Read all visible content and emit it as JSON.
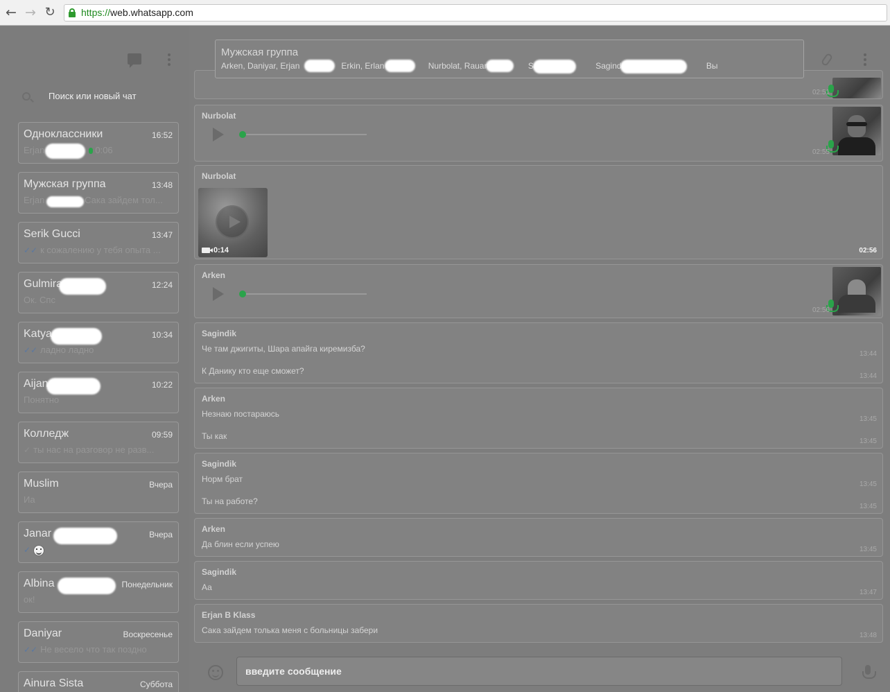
{
  "browser": {
    "url_scheme": "https://",
    "url_rest": "web.whatsapp.com"
  },
  "sidebar": {
    "search_placeholder": "Поиск или новый чат",
    "chats": [
      {
        "name": "Одноклассники",
        "time": "16:52",
        "last": "Erjan",
        "duration": "0:06",
        "ticks": "",
        "mic": true
      },
      {
        "name": "Мужская группа",
        "time": "13:48",
        "last": "Erjan                Сака зайдем тол...",
        "ticks": ""
      },
      {
        "name": "Serik Gucci",
        "time": "13:47",
        "last": "к сожалению у тебя опыта ...",
        "ticks": "✓✓"
      },
      {
        "name": "Gulmira",
        "time": "12:24",
        "last": "Ок. Спс",
        "ticks": ""
      },
      {
        "name": "Katya",
        "time": "10:34",
        "last": "ладно ладно",
        "ticks": "✓✓"
      },
      {
        "name": "Aijan",
        "time": "10:22",
        "last": "Понятно",
        "ticks": ""
      },
      {
        "name": "Колледж",
        "time": "09:59",
        "last": "ты нас на разговор не разв...",
        "ticks": "✓"
      },
      {
        "name": "Muslim",
        "time": "Вчера",
        "last": "Иа",
        "ticks": ""
      },
      {
        "name": "Janar",
        "time": "Вчера",
        "last": "",
        "ticks": "✓",
        "emoji": true
      },
      {
        "name": "Albina",
        "time": "Понедельник",
        "last": "ок!",
        "ticks": ""
      },
      {
        "name": "Daniyar",
        "time": "Воскресенье",
        "last": "Не весело что так поздно",
        "ticks": "✓✓"
      },
      {
        "name": "Ainura Sista",
        "time": "Суббота",
        "last": "",
        "ticks": ""
      }
    ]
  },
  "conversation": {
    "title": "Мужская группа",
    "members": "Arken, Daniyar, Erjan                  Erkin, Erlan                   Nurbolat, Rauan                 Sagi                      Sagindik, +                              Вы",
    "compose_placeholder": "введите сообщение",
    "messages": [
      {
        "kind": "voice-partial",
        "time": "02:51"
      },
      {
        "kind": "voice",
        "sender": "Nurbolat",
        "time": "02:55"
      },
      {
        "kind": "video",
        "sender": "Nurbolat",
        "duration": "0:14",
        "time": "02:56"
      },
      {
        "kind": "voice",
        "sender": "Arken",
        "time": "02:56"
      },
      {
        "kind": "text",
        "sender": "Sagindik",
        "lines": [
          {
            "text": "Че там джигиты, Шара апайга киремизба?",
            "time": "13:44"
          },
          {
            "text": "К Данику кто еще сможет?",
            "time": "13:44"
          }
        ]
      },
      {
        "kind": "text",
        "sender": "Arken",
        "lines": [
          {
            "text": "Незнаю постараюсь",
            "time": "13:45"
          },
          {
            "text": "Ты как",
            "time": "13:45"
          }
        ]
      },
      {
        "kind": "text",
        "sender": "Sagindik",
        "lines": [
          {
            "text": "Норм брат",
            "time": "13:45"
          },
          {
            "text": "Ты на работе?",
            "time": "13:45"
          }
        ]
      },
      {
        "kind": "text",
        "sender": "Arken",
        "lines": [
          {
            "text": "Да блин если успею",
            "time": "13:45"
          }
        ]
      },
      {
        "kind": "text",
        "sender": "Sagindik",
        "lines": [
          {
            "text": "Аа",
            "time": "13:47"
          }
        ]
      },
      {
        "kind": "text",
        "sender": "Erjan B Klass",
        "lines": [
          {
            "text": "Сака зайдем толька меня с больницы забери",
            "time": "13:48"
          }
        ]
      }
    ]
  }
}
